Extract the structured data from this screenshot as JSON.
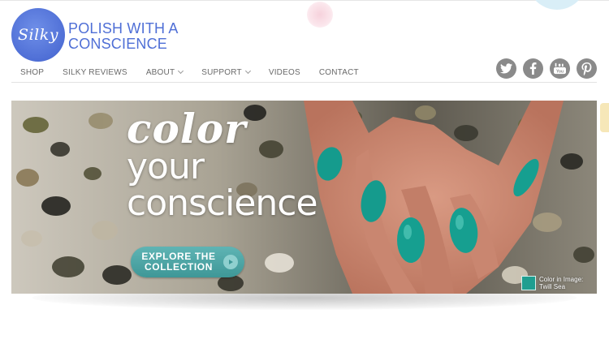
{
  "brand": {
    "logo_text": "Silky",
    "tagline_line1": "POLISH WITH A",
    "tagline_line2": "CONSCIENCE",
    "accent_color": "#4f6fd6"
  },
  "nav": {
    "items": [
      {
        "label": "SHOP",
        "has_dropdown": false
      },
      {
        "label": "SILKY REVIEWS",
        "has_dropdown": false
      },
      {
        "label": "ABOUT",
        "has_dropdown": true
      },
      {
        "label": "SUPPORT",
        "has_dropdown": true
      },
      {
        "label": "VIDEOS",
        "has_dropdown": false
      },
      {
        "label": "CONTACT",
        "has_dropdown": false
      }
    ]
  },
  "social": [
    {
      "name": "twitter-icon"
    },
    {
      "name": "facebook-icon"
    },
    {
      "name": "youtube-icon"
    },
    {
      "name": "pinterest-icon"
    }
  ],
  "hero": {
    "headline_1": "color",
    "headline_2": "your",
    "headline_3": "conscience",
    "cta_line1": "EXPLORE THE",
    "cta_line2": "COLLECTION",
    "swatch_label_1": "Color in Image:",
    "swatch_label_2": "Twill Sea",
    "swatch_color": "#1f9e90"
  }
}
